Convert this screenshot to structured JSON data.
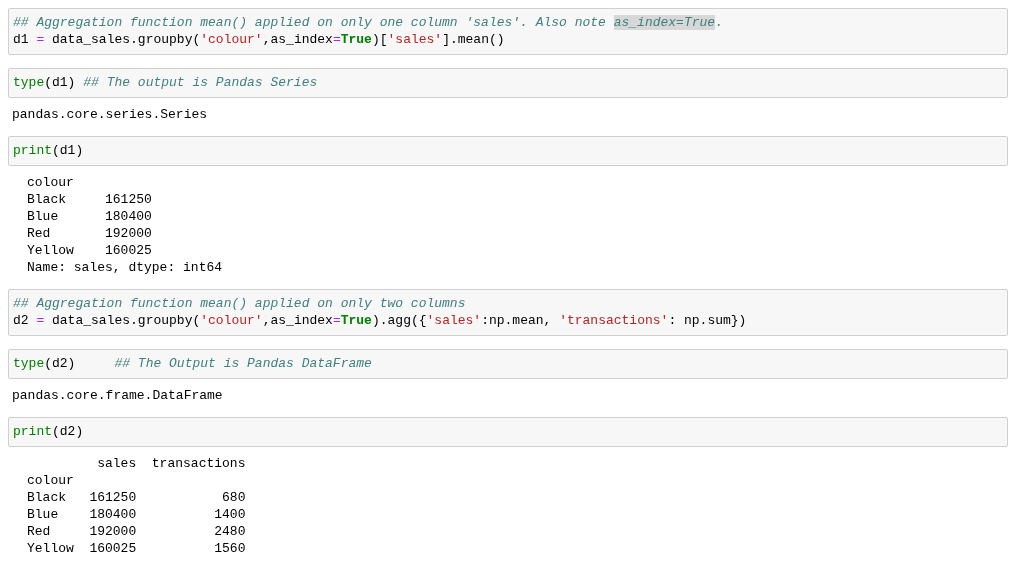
{
  "cells": [
    {
      "input": [
        [
          {
            "kind": "comment",
            "text": "## Aggregation function mean() applied on only one column 'sales'. Also note "
          },
          {
            "kind": "highlight",
            "text": "as_index=True"
          },
          {
            "kind": "comment",
            "text": "."
          }
        ],
        [
          {
            "kind": "plain",
            "text": "d1 "
          },
          {
            "kind": "operator",
            "text": "="
          },
          {
            "kind": "plain",
            "text": " data_sales.groupby("
          },
          {
            "kind": "string",
            "text": "'colour'"
          },
          {
            "kind": "plain",
            "text": ",as_index"
          },
          {
            "kind": "operator",
            "text": "="
          },
          {
            "kind": "keyword",
            "text": "True"
          },
          {
            "kind": "plain",
            "text": ")["
          },
          {
            "kind": "string",
            "text": "'sales'"
          },
          {
            "kind": "plain",
            "text": "].mean()"
          }
        ]
      ]
    },
    {
      "input": [
        [
          {
            "kind": "builtin",
            "text": "type"
          },
          {
            "kind": "plain",
            "text": "(d1) "
          },
          {
            "kind": "comment",
            "text": "## The output is Pandas Series"
          }
        ]
      ],
      "output": {
        "kind": "result",
        "lines": [
          "pandas.core.series.Series"
        ]
      }
    },
    {
      "input": [
        [
          {
            "kind": "builtin",
            "text": "print"
          },
          {
            "kind": "plain",
            "text": "(d1)"
          }
        ]
      ],
      "output": {
        "kind": "stream",
        "lines": [
          "colour",
          "Black     161250",
          "Blue      180400",
          "Red       192000",
          "Yellow    160025",
          "Name: sales, dtype: int64"
        ]
      }
    },
    {
      "input": [
        [
          {
            "kind": "comment",
            "text": "## Aggregation function mean() applied on only two columns"
          }
        ],
        [
          {
            "kind": "plain",
            "text": "d2 "
          },
          {
            "kind": "operator",
            "text": "="
          },
          {
            "kind": "plain",
            "text": " data_sales.groupby("
          },
          {
            "kind": "string",
            "text": "'colour'"
          },
          {
            "kind": "plain",
            "text": ",as_index"
          },
          {
            "kind": "operator",
            "text": "="
          },
          {
            "kind": "keyword",
            "text": "True"
          },
          {
            "kind": "plain",
            "text": ").agg({"
          },
          {
            "kind": "string",
            "text": "'sales'"
          },
          {
            "kind": "plain",
            "text": ":np.mean, "
          },
          {
            "kind": "string",
            "text": "'transactions'"
          },
          {
            "kind": "plain",
            "text": ": np.sum})"
          }
        ]
      ]
    },
    {
      "input": [
        [
          {
            "kind": "builtin",
            "text": "type"
          },
          {
            "kind": "plain",
            "text": "(d2)     "
          },
          {
            "kind": "comment",
            "text": "## The Output is Pandas DataFrame"
          }
        ]
      ],
      "output": {
        "kind": "result",
        "lines": [
          "pandas.core.frame.DataFrame"
        ]
      }
    },
    {
      "input": [
        [
          {
            "kind": "builtin",
            "text": "print"
          },
          {
            "kind": "plain",
            "text": "(d2)"
          }
        ]
      ],
      "output": {
        "kind": "stream",
        "lines": [
          "         sales  transactions",
          "colour                      ",
          "Black   161250           680",
          "Blue    180400          1400",
          "Red     192000          2480",
          "Yellow  160025          1560"
        ]
      }
    }
  ]
}
